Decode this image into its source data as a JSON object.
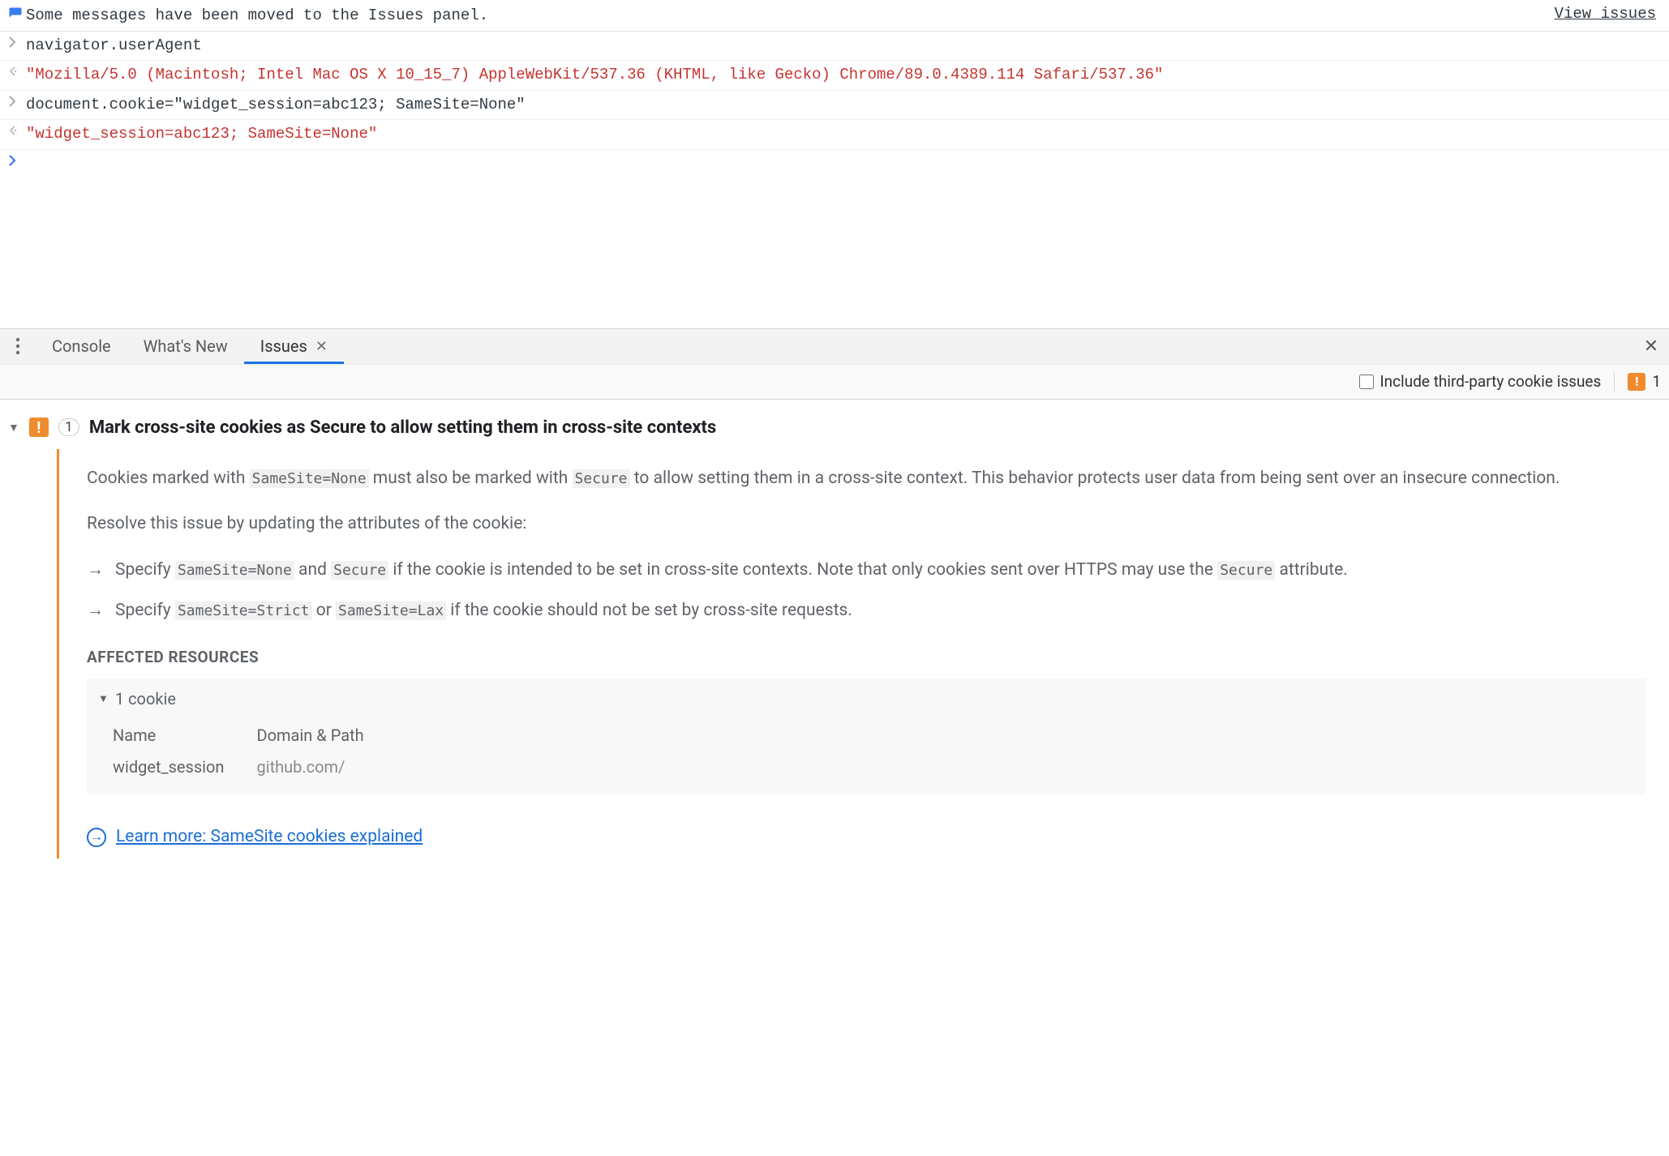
{
  "info_row": {
    "message": "Some messages have been moved to the Issues panel.",
    "view_link": "View issues"
  },
  "console": {
    "lines": [
      {
        "kind": "input",
        "text": "navigator.userAgent"
      },
      {
        "kind": "output",
        "text": "\"Mozilla/5.0 (Macintosh; Intel Mac OS X 10_15_7) AppleWebKit/537.36 (KHTML, like Gecko) Chrome/89.0.4389.114 Safari/537.36\""
      },
      {
        "kind": "input",
        "text": "document.cookie=\"widget_session=abc123; SameSite=None\""
      },
      {
        "kind": "output",
        "text": "\"widget_session=abc123; SameSite=None\""
      }
    ]
  },
  "tabs": {
    "items": [
      "Console",
      "What's New",
      "Issues"
    ],
    "active_index": 2
  },
  "filter": {
    "checkbox_label": "Include third-party cookie issues",
    "badge_count": "1"
  },
  "issue": {
    "count": "1",
    "title": "Mark cross-site cookies as Secure to allow setting them in cross-site contexts",
    "p1_a": "Cookies marked with ",
    "p1_code1": "SameSite=None",
    "p1_b": " must also be marked with ",
    "p1_code2": "Secure",
    "p1_c": " to allow setting them in a cross-site context. This behavior protects user data from being sent over an insecure connection.",
    "p2": "Resolve this issue by updating the attributes of the cookie:",
    "b1_a": "Specify ",
    "b1_code1": "SameSite=None",
    "b1_b": " and ",
    "b1_code2": "Secure",
    "b1_c": " if the cookie is intended to be set in cross-site contexts. Note that only cookies sent over HTTPS may use the ",
    "b1_code3": "Secure",
    "b1_d": " attribute.",
    "b2_a": "Specify ",
    "b2_code1": "SameSite=Strict",
    "b2_b": " or ",
    "b2_code2": "SameSite=Lax",
    "b2_c": " if the cookie should not be set by cross-site requests.",
    "affected_heading": "AFFECTED RESOURCES",
    "affected_summary": "1 cookie",
    "table": {
      "col1": "Name",
      "col2": "Domain & Path",
      "row": {
        "name": "widget_session",
        "domain": "github.com/"
      }
    },
    "learn_more": "Learn more: SameSite cookies explained"
  }
}
